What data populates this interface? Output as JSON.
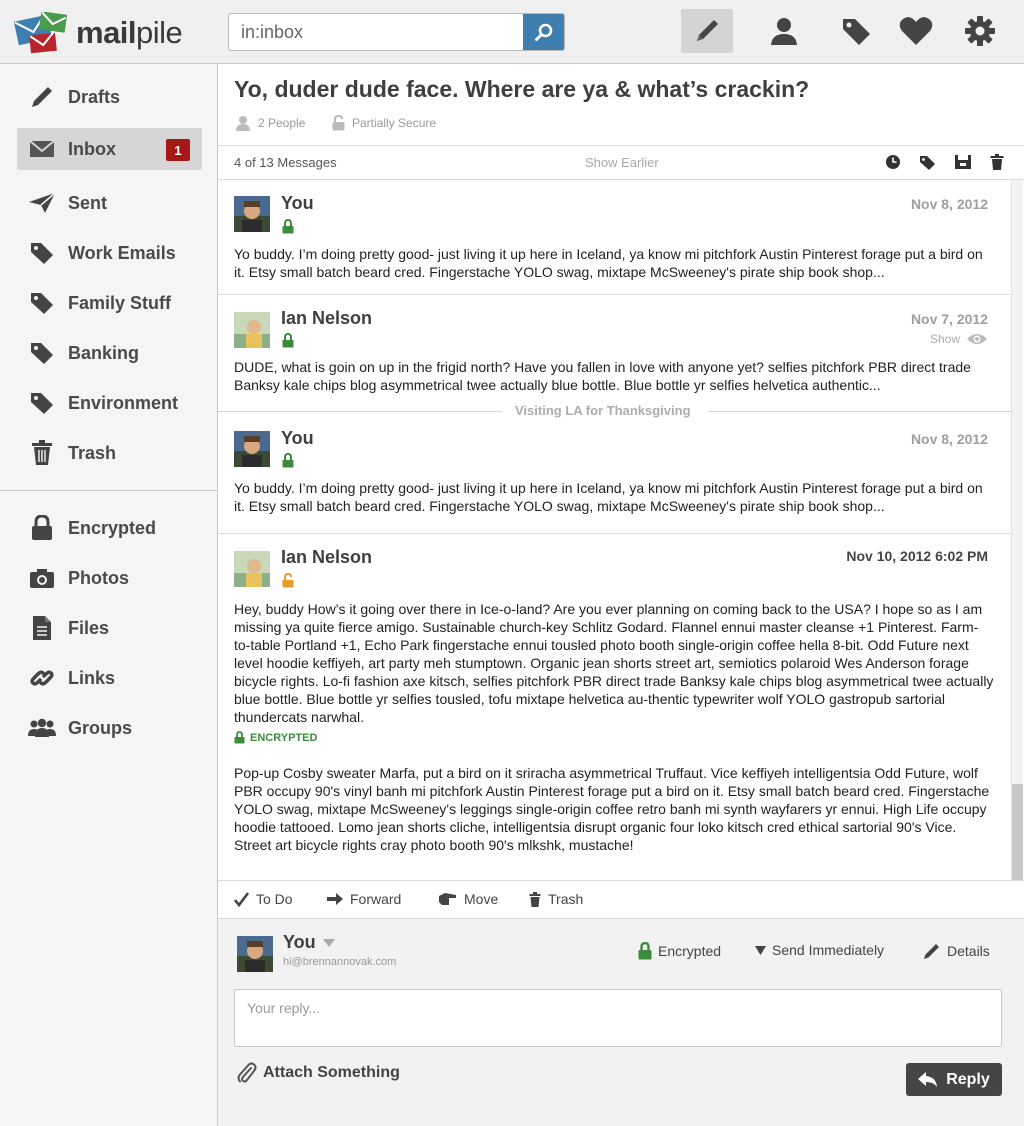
{
  "app": {
    "logo_text_bold": "mail",
    "logo_text_light": "pile"
  },
  "search": {
    "value": "in:inbox"
  },
  "sidebar": {
    "items": [
      {
        "label": "Drafts",
        "icon": "pencil-icon"
      },
      {
        "label": "Inbox",
        "icon": "envelope-icon",
        "badge": "1",
        "selected": true
      },
      {
        "label": "Sent",
        "icon": "paper-plane-icon"
      },
      {
        "label": "Work Emails",
        "icon": "tag-icon"
      },
      {
        "label": "Family Stuff",
        "icon": "tag-icon"
      },
      {
        "label": "Banking",
        "icon": "tag-icon"
      },
      {
        "label": "Environment",
        "icon": "tag-icon"
      },
      {
        "label": "Trash",
        "icon": "trash-icon"
      },
      {
        "label": "Encrypted",
        "icon": "lock-icon"
      },
      {
        "label": "Photos",
        "icon": "camera-icon"
      },
      {
        "label": "Files",
        "icon": "file-icon"
      },
      {
        "label": "Links",
        "icon": "link-icon"
      },
      {
        "label": "Groups",
        "icon": "group-icon"
      }
    ]
  },
  "thread": {
    "subject": "Yo, duder dude face. Where are ya & what’s crackin?",
    "people": "2 People",
    "security": "Partially Secure",
    "count": "4 of 13 Messages",
    "show_earlier": "Show Earlier"
  },
  "messages": [
    {
      "sender": "You",
      "date": "Nov 8, 2012",
      "preview": "Yo buddy. I’m doing pretty good- just living it up here in Iceland, ya know mi pitchfork Austin Pinterest forage put a bird on it. Etsy small batch beard cred. Fingerstache YOLO swag, mixtape McSweeney's pirate ship book shop..."
    },
    {
      "sender": "Ian Nelson",
      "date": "Nov 7, 2012",
      "show": "Show",
      "preview": "DUDE, what is goin on up in the frigid north? Have you fallen in love with anyone yet? selfies pitchfork PBR direct trade Banksy kale chips blog asymmetrical twee actually blue bottle. Blue bottle yr selfies helvetica authentic..."
    },
    {
      "sender": "You",
      "date": "Nov 8, 2012",
      "preview": "Yo buddy. I’m doing pretty good- just living it up here in Iceland, ya know mi pitchfork Austin Pinterest forage put a bird on it. Etsy small batch beard cred. Fingerstache YOLO swag, mixtape McSweeney's pirate ship book shop..."
    },
    {
      "sender": "Ian Nelson",
      "date": "Nov 10, 2012 6:02 PM",
      "body1": "Hey, buddy  How’s it going over there in Ice-o-land? Are you ever planning on coming back to the USA? I hope so as I am missing ya quite fierce amigo. Sustainable church-key Schlitz Godard. Flannel ennui master cleanse +1 Pinterest. Farm-to-table Portland +1, Echo Park fingerstache ennui tousled photo booth single-origin coffee hella 8-bit. Odd Future next level hoodie keffiyeh, art party meh stumptown. Organic jean shorts street art, semiotics polaroid Wes Anderson forage bicycle rights. Lo-fi fashion axe kitsch, selfies pitchfork PBR direct trade Banksy kale chips blog asymmetrical twee actually blue bottle. Blue bottle yr selfies tousled, tofu mixtape helvetica au-thentic typewriter wolf YOLO gastropub sartorial thundercats narwhal.",
      "encrypted_label": "ENCRYPTED",
      "body2": "Pop-up Cosby sweater Marfa, put a bird on it sriracha asymmetrical Truffaut. Vice keffiyeh intelligentsia Odd Future, wolf PBR occupy 90's vinyl banh mi pitchfork Austin Pinterest forage put a bird on it. Etsy small batch beard cred. Fingerstache YOLO swag, mixtape McSweeney's leggings single-origin coffee retro banh mi synth wayfarers yr ennui. High Life occupy hoodie tattooed. Lomo jean shorts cliche, intelligentsia disrupt organic four loko kitsch cred ethical sartorial 90's Vice. Street art bicycle rights cray photo booth 90's mlkshk, mustache!"
    }
  ],
  "separator": "Visiting LA for Thanksgiving",
  "actions": {
    "todo": "To Do",
    "forward": "Forward",
    "move": "Move",
    "trash": "Trash"
  },
  "reply": {
    "from_name": "You",
    "from_email": "hi@brennannovak.com",
    "encrypted": "Encrypted",
    "send_mode": "Send Immediately",
    "details": "Details",
    "placeholder": "Your reply...",
    "attach": "Attach Something",
    "button": "Reply"
  },
  "colors": {
    "accent_blue": "#3e7fb0",
    "badge_red": "#a41818",
    "secure_green": "#3d8b3d",
    "insecure_orange": "#e89a2c"
  }
}
